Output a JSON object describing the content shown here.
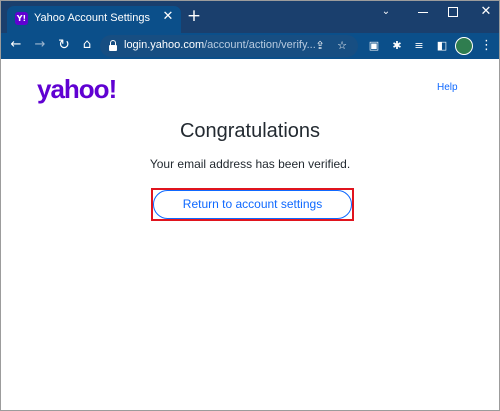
{
  "browser": {
    "tab": {
      "favicon_text": "Y!",
      "title": "Yahoo Account Settings",
      "close_glyph": "✕"
    },
    "new_tab_glyph": "+",
    "window_controls": {
      "chevron_glyph": "⌄",
      "close_glyph": "✕"
    },
    "toolbar": {
      "back_glyph": "←",
      "forward_glyph": "→",
      "reload_glyph": "↻",
      "home_glyph": "⌂",
      "url_host": "login.yahoo.com",
      "url_path": "/account/action/verify...",
      "share_glyph": "⇪",
      "star_glyph": "☆",
      "extension_glyphs": [
        "▣",
        "✱",
        "≡",
        "◧"
      ],
      "menu_glyph": "⋮"
    },
    "colors": {
      "tab_strip": "#1a3f6d",
      "toolbar": "#0b4f8a",
      "brand_purple": "#6001d2",
      "link_blue": "#0f69ff",
      "highlight_red": "#e0141e"
    }
  },
  "page": {
    "logo_text": "yahoo!",
    "help_link": "Help",
    "heading": "Congratulations",
    "message": "Your email address has been verified.",
    "return_button": "Return to account settings"
  }
}
